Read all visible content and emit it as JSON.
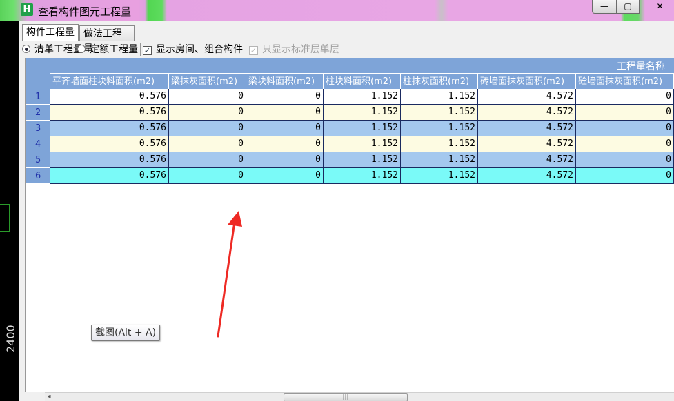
{
  "window": {
    "title": "查看构件图元工程量",
    "icon_letter": "H",
    "minimize_glyph": "—",
    "maximize_glyph": "▢",
    "close_glyph": "✕"
  },
  "cad": {
    "dimension_text": "2400"
  },
  "tabs": [
    {
      "label": "构件工程量",
      "active": true
    },
    {
      "label": "做法工程量",
      "active": false
    }
  ],
  "options": {
    "radio_list": "清单工程量",
    "radio_quota": "定额工程量",
    "show_rooms": "显示房间、组合构件",
    "only_standard_floor": "只显示标准层单层"
  },
  "grid": {
    "group_header": "工程量名称",
    "columns": [
      "平齐墙面柱块料面积(m2)",
      "梁抹灰面积(m2)",
      "梁块料面积(m2)",
      "柱块料面积(m2)",
      "柱抹灰面积(m2)",
      "砖墙面抹灰面积(m2)",
      "砼墙面抹灰面积(m2)"
    ],
    "rows": [
      {
        "num": "1",
        "style": "white",
        "values": [
          "0.576",
          "0",
          "0",
          "1.152",
          "1.152",
          "4.572",
          "0"
        ]
      },
      {
        "num": "2",
        "style": "yellow",
        "values": [
          "0.576",
          "0",
          "0",
          "1.152",
          "1.152",
          "4.572",
          "0"
        ]
      },
      {
        "num": "3",
        "style": "blue",
        "values": [
          "0.576",
          "0",
          "0",
          "1.152",
          "1.152",
          "4.572",
          "0"
        ]
      },
      {
        "num": "4",
        "style": "yellow",
        "values": [
          "0.576",
          "0",
          "0",
          "1.152",
          "1.152",
          "4.572",
          "0"
        ]
      },
      {
        "num": "5",
        "style": "blue",
        "values": [
          "0.576",
          "0",
          "0",
          "1.152",
          "1.152",
          "4.572",
          "0"
        ]
      },
      {
        "num": "6",
        "style": "cyan",
        "values": [
          "0.576",
          "0",
          "0",
          "1.152",
          "1.152",
          "4.572",
          "0"
        ]
      }
    ]
  },
  "tooltip": {
    "text": "截图(Alt + A)"
  },
  "scrollbar": {
    "left_glyph": "◂",
    "thumb_grip": "|||"
  },
  "colors": {
    "header_blue": "#7ea4d8",
    "row_yellow": "#fdfbe2",
    "row_blue": "#a4c8ee",
    "row_cyan": "#7afaf8",
    "arrow_red": "#ee2a24"
  }
}
